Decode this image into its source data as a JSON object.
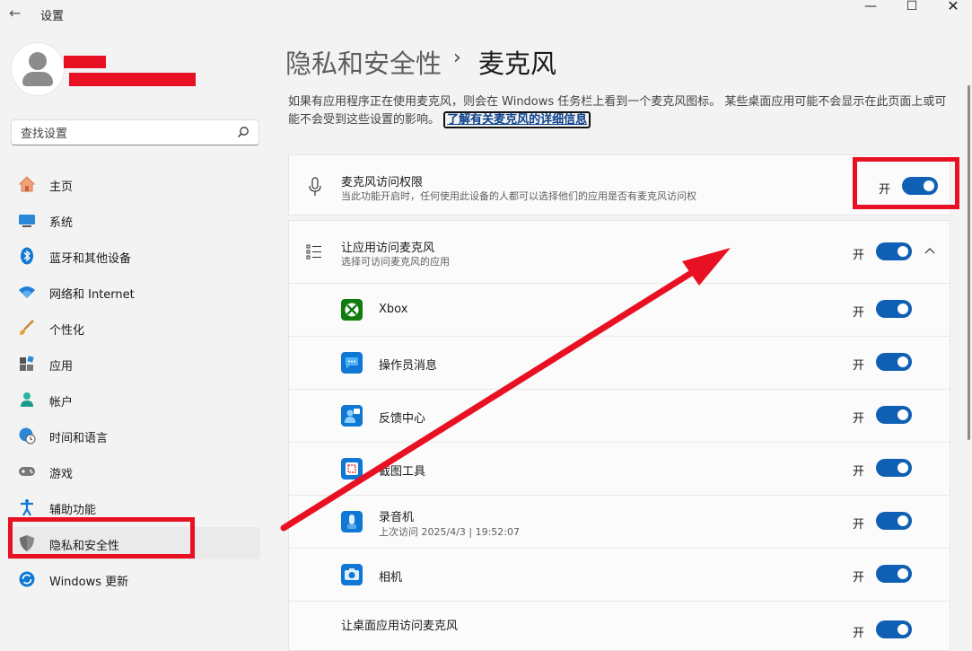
{
  "window": {
    "title": "设置"
  },
  "search": {
    "placeholder": "查找设置"
  },
  "nav": {
    "items": [
      {
        "label": "主页",
        "icon": "home-icon"
      },
      {
        "label": "系统",
        "icon": "system-icon"
      },
      {
        "label": "蓝牙和其他设备",
        "icon": "bluetooth-icon"
      },
      {
        "label": "网络和 Internet",
        "icon": "wifi-icon"
      },
      {
        "label": "个性化",
        "icon": "brush-icon"
      },
      {
        "label": "应用",
        "icon": "apps-icon"
      },
      {
        "label": "帐户",
        "icon": "account-icon"
      },
      {
        "label": "时间和语言",
        "icon": "globe-clock-icon"
      },
      {
        "label": "游戏",
        "icon": "gamepad-icon"
      },
      {
        "label": "辅助功能",
        "icon": "accessibility-icon"
      },
      {
        "label": "隐私和安全性",
        "icon": "shield-icon"
      },
      {
        "label": "Windows 更新",
        "icon": "update-icon"
      }
    ],
    "selected": "隐私和安全性"
  },
  "header": {
    "crumb_parent": "隐私和安全性",
    "separator": "›",
    "crumb_current": "麦克风"
  },
  "description": {
    "text": "如果有应用程序正在使用麦克风，则会在 Windows 任务栏上看到一个麦克风图标。 某些桌面应用可能不会显示在此页面上或可能不会受到这些设置的影响。",
    "link": "了解有关麦克风的详细信息"
  },
  "mic_access": {
    "title": "麦克风访问权限",
    "subtitle": "当此功能开启时，任何使用此设备的人都可以选择他们的应用是否有麦克风访问权",
    "state": "开"
  },
  "apps_access": {
    "title": "让应用访问麦克风",
    "subtitle": "选择可访问麦克风的应用",
    "state": "开"
  },
  "apps": [
    {
      "name": "Xbox",
      "state": "开",
      "icon": "xbox-icon",
      "color": "#107c10"
    },
    {
      "name": "操作员消息",
      "state": "开",
      "icon": "message-icon",
      "color": "#0f78d4"
    },
    {
      "name": "反馈中心",
      "state": "开",
      "icon": "feedback-icon",
      "color": "#0f78d4"
    },
    {
      "name": "截图工具",
      "state": "开",
      "icon": "snipping-icon",
      "color": "#0f78d4"
    },
    {
      "name": "录音机",
      "state": "开",
      "icon": "recorder-icon",
      "color": "#0f78d4",
      "sub": "上次访问 2025/4/3 | 19:52:07"
    },
    {
      "name": "相机",
      "state": "开",
      "icon": "camera-icon",
      "color": "#0f78d4"
    }
  ],
  "desktop_access": {
    "title": "让桌面应用访问麦克风",
    "state": "开"
  },
  "colors": {
    "accent": "#0f5fb5",
    "annotation_red": "#e81123"
  }
}
